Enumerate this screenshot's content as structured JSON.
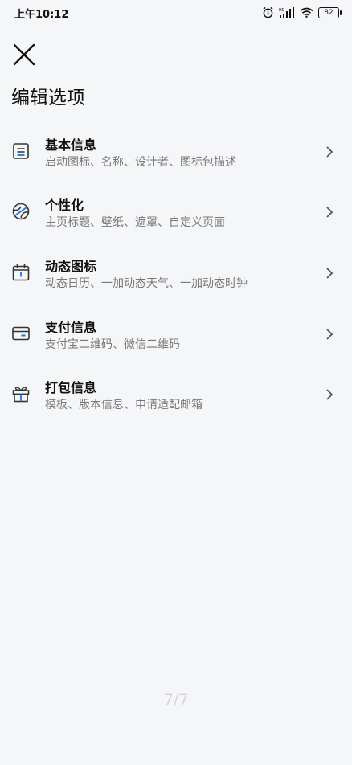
{
  "status": {
    "time": "上午10:12",
    "battery": "82",
    "hd": "HD"
  },
  "header": {
    "title": "编辑选项"
  },
  "items": [
    {
      "label": "基本信息",
      "desc": "启动图标、名称、设计者、图标包描述",
      "icon": "info-card-icon"
    },
    {
      "label": "个性化",
      "desc": "主页标题、壁纸、遮罩、自定义页面",
      "icon": "palette-icon"
    },
    {
      "label": "动态图标",
      "desc": "动态日历、一加动态天气、一加动态时钟",
      "icon": "calendar-icon"
    },
    {
      "label": "支付信息",
      "desc": "支付宝二维码、微信二维码",
      "icon": "card-icon"
    },
    {
      "label": "打包信息",
      "desc": "模板、版本信息、申请适配邮箱",
      "icon": "gift-icon"
    }
  ],
  "pager": "7/7"
}
